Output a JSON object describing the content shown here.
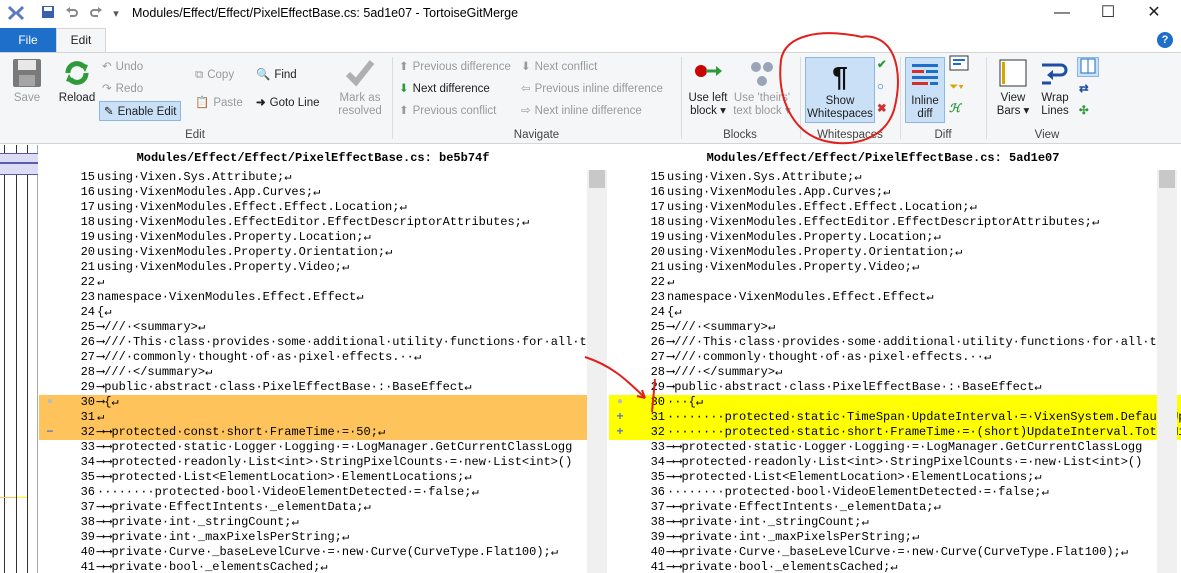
{
  "titlebar": {
    "title": "Modules/Effect/Effect/PixelEffectBase.cs: 5ad1e07 - TortoiseGitMerge",
    "minimize": "—",
    "maximize": "☐",
    "close": "✕"
  },
  "tabs": {
    "file": "File",
    "edit": "Edit",
    "help": "?"
  },
  "ribbon": {
    "edit_group": {
      "label": "Edit",
      "save": "Save",
      "reload": "Reload",
      "undo": "Undo",
      "redo": "Redo",
      "enable_edit": "Enable Edit",
      "copy": "Copy",
      "paste": "Paste",
      "find": "Find",
      "goto_line": "Goto Line",
      "mark_resolved_1": "Mark as",
      "mark_resolved_2": "resolved"
    },
    "navigate_group": {
      "label": "Navigate",
      "prev_diff": "Previous difference",
      "next_diff": "Next difference",
      "prev_conflict": "Previous conflict",
      "next_conflict": "Next conflict",
      "prev_inline": "Previous inline difference",
      "next_inline": "Next inline difference"
    },
    "blocks_group": {
      "label": "Blocks",
      "use_left_1": "Use left",
      "use_left_2": "block ▾",
      "use_theirs_1": "Use 'theirs'",
      "use_theirs_2": "text block ▾"
    },
    "whitespaces_group": {
      "label": "Whitespaces",
      "show_ws_1": "Show",
      "show_ws_2": "Whitespaces"
    },
    "diff_group": {
      "label": "Diff",
      "inline_diff_1": "Inline",
      "inline_diff_2": "diff"
    },
    "view_group": {
      "label": "View",
      "view_bars_1": "View",
      "view_bars_2": "Bars ▾",
      "wrap_lines_1": "Wrap",
      "wrap_lines_2": "Lines"
    }
  },
  "left_pane": {
    "header": "Modules/Effect/Effect/PixelEffectBase.cs: be5b74f",
    "lines": [
      {
        "n": "15",
        "t": "using·Vixen.Sys.Attribute;↵",
        "k": "n"
      },
      {
        "n": "16",
        "t": "using·VixenModules.App.Curves;↵",
        "k": "n"
      },
      {
        "n": "17",
        "t": "using·VixenModules.Effect.Effect.Location;↵",
        "k": "n"
      },
      {
        "n": "18",
        "t": "using·VixenModules.EffectEditor.EffectDescriptorAttributes;↵",
        "k": "n"
      },
      {
        "n": "19",
        "t": "using·VixenModules.Property.Location;↵",
        "k": "n"
      },
      {
        "n": "20",
        "t": "using·VixenModules.Property.Orientation;↵",
        "k": "n"
      },
      {
        "n": "21",
        "t": "using·VixenModules.Property.Video;↵",
        "k": "n"
      },
      {
        "n": "22",
        "t": "↵",
        "k": "n"
      },
      {
        "n": "23",
        "t": "namespace·VixenModules.Effect.Effect↵",
        "k": "n"
      },
      {
        "n": "24",
        "t": "{↵",
        "k": "n"
      },
      {
        "n": "25",
        "t": "⟶///·<summary>↵",
        "k": "n"
      },
      {
        "n": "26",
        "t": "⟶///·This·class·provides·some·additional·utility·functions·for·all·th",
        "k": "n"
      },
      {
        "n": "27",
        "t": "⟶///·commonly·thought·of·as·pixel·effects.··↵",
        "k": "n"
      },
      {
        "n": "28",
        "t": "⟶///·</summary>↵",
        "k": "n"
      },
      {
        "n": "29",
        "t": "⟶public·abstract·class·PixelEffectBase·:·BaseEffect↵",
        "k": "n"
      },
      {
        "n": "30",
        "t": "⟶{↵",
        "k": "c",
        "m": "●"
      },
      {
        "n": "31",
        "t": "↵",
        "k": "c",
        "m": ""
      },
      {
        "n": "32",
        "t": "⟶⟶protected·const·short·FrameTime·=·50;↵",
        "k": "d",
        "m": "−"
      },
      {
        "n": "33",
        "t": "⟶⟶protected·static·Logger·Logging·=·LogManager.GetCurrentClassLogg",
        "k": "n"
      },
      {
        "n": "34",
        "t": "⟶⟶protected·readonly·List<int>·StringPixelCounts·=·new·List<int>()",
        "k": "n"
      },
      {
        "n": "35",
        "t": "⟶⟶protected·List<ElementLocation>·ElementLocations;↵",
        "k": "n"
      },
      {
        "n": "36",
        "t": "········protected·bool·VideoElementDetected·=·false;↵",
        "k": "n"
      },
      {
        "n": "37",
        "t": "⟶⟶private·EffectIntents·_elementData;↵",
        "k": "n"
      },
      {
        "n": "38",
        "t": "⟶⟶private·int·_stringCount;↵",
        "k": "n"
      },
      {
        "n": "39",
        "t": "⟶⟶private·int·_maxPixelsPerString;↵",
        "k": "n"
      },
      {
        "n": "40",
        "t": "⟶⟶private·Curve·_baseLevelCurve·=·new·Curve(CurveType.Flat100);↵",
        "k": "n"
      },
      {
        "n": "41",
        "t": "⟶⟶private·bool·_elementsCached;↵",
        "k": "n"
      }
    ]
  },
  "right_pane": {
    "header": "Modules/Effect/Effect/PixelEffectBase.cs: 5ad1e07",
    "lines": [
      {
        "n": "15",
        "t": "using·Vixen.Sys.Attribute;↵",
        "k": "n"
      },
      {
        "n": "16",
        "t": "using·VixenModules.App.Curves;↵",
        "k": "n"
      },
      {
        "n": "17",
        "t": "using·VixenModules.Effect.Effect.Location;↵",
        "k": "n"
      },
      {
        "n": "18",
        "t": "using·VixenModules.EffectEditor.EffectDescriptorAttributes;↵",
        "k": "n"
      },
      {
        "n": "19",
        "t": "using·VixenModules.Property.Location;↵",
        "k": "n"
      },
      {
        "n": "20",
        "t": "using·VixenModules.Property.Orientation;↵",
        "k": "n"
      },
      {
        "n": "21",
        "t": "using·VixenModules.Property.Video;↵",
        "k": "n"
      },
      {
        "n": "22",
        "t": "↵",
        "k": "n"
      },
      {
        "n": "23",
        "t": "namespace·VixenModules.Effect.Effect↵",
        "k": "n"
      },
      {
        "n": "24",
        "t": "{↵",
        "k": "n"
      },
      {
        "n": "25",
        "t": "⟶///·<summary>↵",
        "k": "n"
      },
      {
        "n": "26",
        "t": "⟶///·This·class·provides·some·additional·utility·functions·for·all·th",
        "k": "n"
      },
      {
        "n": "27",
        "t": "⟶///·commonly·thought·of·as·pixel·effects.··↵",
        "k": "n"
      },
      {
        "n": "28",
        "t": "⟶///·</summary>↵",
        "k": "n"
      },
      {
        "n": "29",
        "t": "⟶public·abstract·class·PixelEffectBase·:·BaseEffect↵",
        "k": "n"
      },
      {
        "n": "30",
        "t": "···{↵",
        "k": "c",
        "m": "●"
      },
      {
        "n": "31",
        "t": "········protected·static·TimeSpan·UpdateInterval·=·VixenSystem.DefaultUp",
        "k": "a",
        "m": "+"
      },
      {
        "n": "32",
        "t": "········protected·static·short·FrameTime·=·(short)UpdateInterval.TotalMi",
        "k": "a",
        "m": "+"
      },
      {
        "n": "33",
        "t": "⟶⟶protected·static·Logger·Logging·=·LogManager.GetCurrentClassLogg",
        "k": "n"
      },
      {
        "n": "34",
        "t": "⟶⟶protected·readonly·List<int>·StringPixelCounts·=·new·List<int>()",
        "k": "n"
      },
      {
        "n": "35",
        "t": "⟶⟶protected·List<ElementLocation>·ElementLocations;↵",
        "k": "n"
      },
      {
        "n": "36",
        "t": "········protected·bool·VideoElementDetected·=·false;↵",
        "k": "n"
      },
      {
        "n": "37",
        "t": "⟶⟶private·EffectIntents·_elementData;↵",
        "k": "n"
      },
      {
        "n": "38",
        "t": "⟶⟶private·int·_stringCount;↵",
        "k": "n"
      },
      {
        "n": "39",
        "t": "⟶⟶private·int·_maxPixelsPerString;↵",
        "k": "n"
      },
      {
        "n": "40",
        "t": "⟶⟶private·Curve·_baseLevelCurve·=·new·Curve(CurveType.Flat100);↵",
        "k": "n"
      },
      {
        "n": "41",
        "t": "⟶⟶private·bool·_elementsCached;↵",
        "k": "n"
      }
    ]
  },
  "colors": {
    "left_header": "#ffc35c",
    "right_header": "#ffff00",
    "changed_left": "#ffc35c",
    "changed_right": "#ffff00",
    "removed": "#ffc35c",
    "added": "#ffff00",
    "annotation": "#e0201c"
  }
}
